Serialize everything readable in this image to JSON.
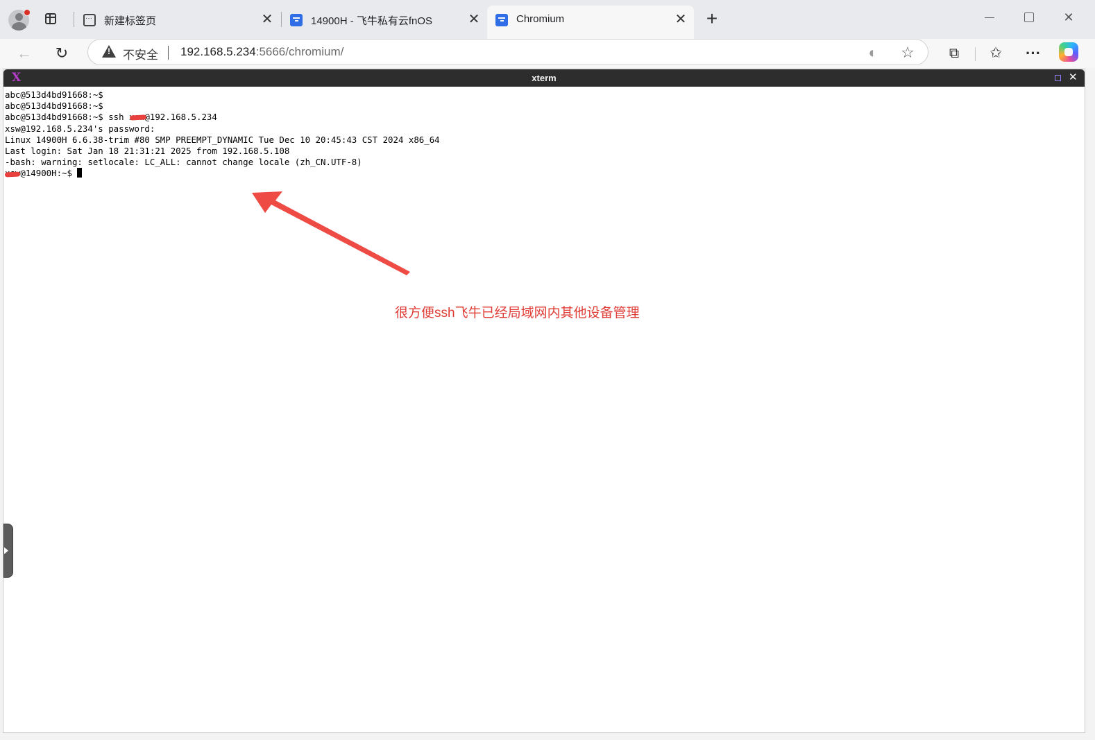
{
  "tabs": [
    {
      "title": "新建标签页",
      "favicon": "new-tab-icon",
      "active": false
    },
    {
      "title": "14900H - 飞牛私有云fnOS",
      "favicon": "fnos-icon",
      "active": false
    },
    {
      "title": "Chromium",
      "favicon": "fnos-icon",
      "active": true
    }
  ],
  "toolbar": {
    "security_label": "不安全",
    "url_host": "192.168.5.234",
    "url_path": ":5666/chromium/"
  },
  "xterm": {
    "title": "xterm",
    "lines": [
      "abc@513d4bd91668:~$",
      "abc@513d4bd91668:~$",
      "abc@513d4bd91668:~$ ssh xsw@192.168.5.234",
      "xsw@192.168.5.234's password:",
      "Linux 14900H 6.6.38-trim #80 SMP PREEMPT_DYNAMIC Tue Dec 10 20:45:43 CST 2024 x86_64",
      "Last login: Sat Jan 18 21:31:21 2025 from 192.168.5.108",
      "-bash: warning: setlocale: LC_ALL: cannot change locale (zh_CN.UTF-8)",
      "xsw@14900H:~$ "
    ]
  },
  "annotation": {
    "text": "很方便ssh飞牛已经局域网内其他设备管理",
    "color": "#e03c36"
  },
  "colors": {
    "tabstrip": "#e9eaed",
    "toolbar": "#f7f7f7",
    "xterm_titlebar": "#2d2d2d",
    "favicon_blue": "#2f6ee6"
  }
}
